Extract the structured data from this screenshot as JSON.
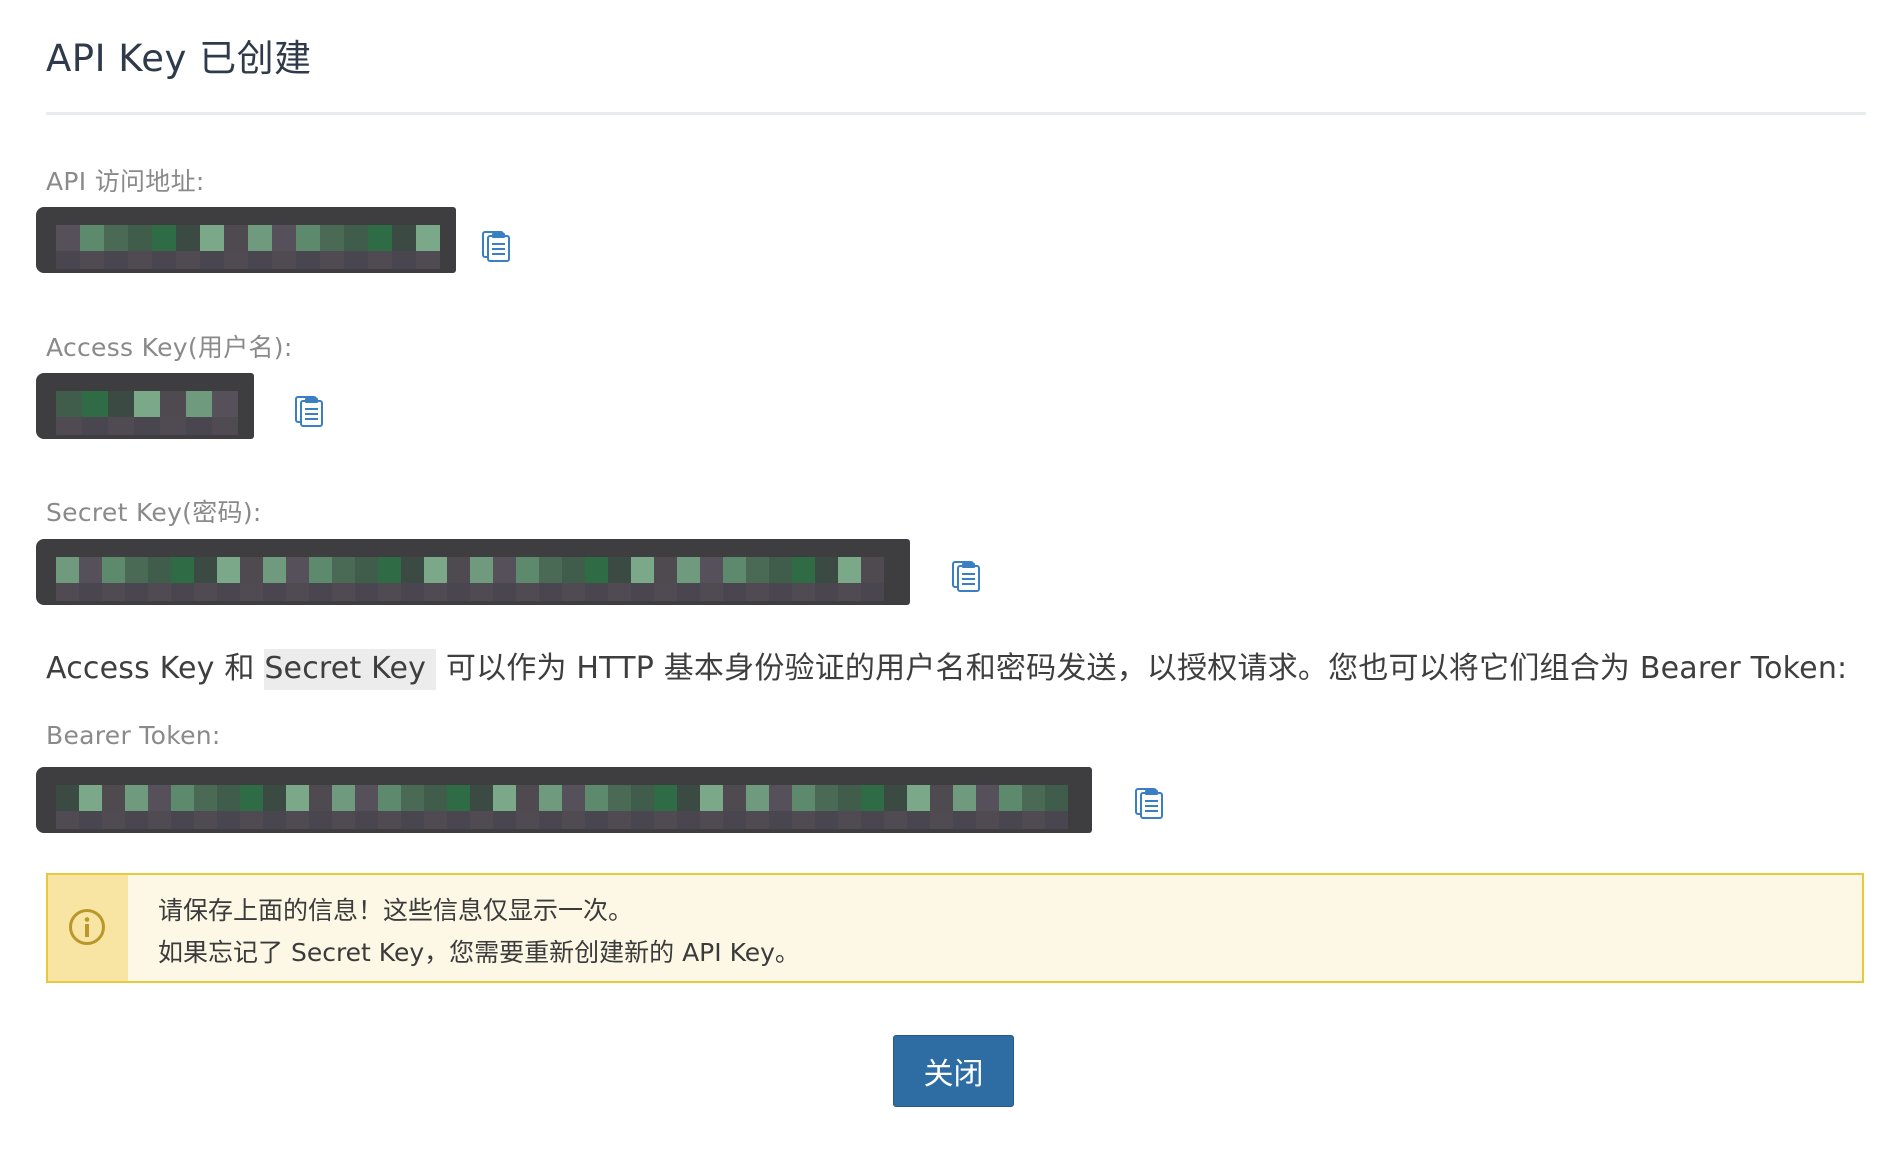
{
  "dialog": {
    "title": "API Key 已创建"
  },
  "fields": {
    "api_url": {
      "label": "API 访问地址:",
      "value": ""
    },
    "access_key": {
      "label": "Access Key(用户名):",
      "value": ""
    },
    "secret_key": {
      "label": "Secret Key(密码):",
      "value": ""
    },
    "bearer_token": {
      "label": "Bearer Token:",
      "value": ""
    }
  },
  "note": {
    "part1": "Access Key 和 ",
    "highlight": "Secret Key",
    "part2": " 可以作为 HTTP 基本身份验证的用户名和密码发送，以授权请求。您也可以将它们组合为 Bearer Token:"
  },
  "warning": {
    "line1": "请保存上面的信息！这些信息仅显示一次。",
    "line2": "如果忘记了 Secret Key，您需要重新创建新的 API Key。",
    "icon": "info-icon"
  },
  "buttons": {
    "close_label": "关闭"
  },
  "colors": {
    "primary_button": "#2e6da4",
    "warning_border": "#e8c93e",
    "warning_bg": "#fdf8e6",
    "copy_icon": "#3a7fc4"
  }
}
